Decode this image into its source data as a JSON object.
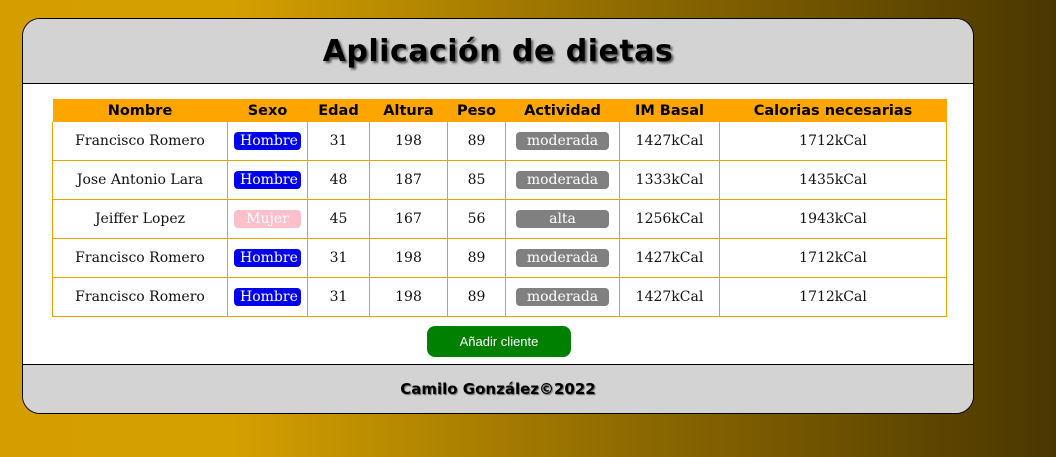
{
  "header": {
    "title": "Aplicación de dietas"
  },
  "table": {
    "columns": [
      "Nombre",
      "Sexo",
      "Edad",
      "Altura",
      "Peso",
      "Actividad",
      "IM Basal",
      "Calorias necesarias"
    ],
    "rows": [
      {
        "nombre": "Francisco Romero",
        "sexo": "Hombre",
        "edad": "31",
        "altura": "198",
        "peso": "89",
        "actividad": "moderada",
        "im_basal": "1427kCal",
        "calorias": "1712kCal"
      },
      {
        "nombre": "Jose Antonio Lara",
        "sexo": "Hombre",
        "edad": "48",
        "altura": "187",
        "peso": "85",
        "actividad": "moderada",
        "im_basal": "1333kCal",
        "calorias": "1435kCal"
      },
      {
        "nombre": "Jeiffer Lopez",
        "sexo": "Mujer",
        "edad": "45",
        "altura": "167",
        "peso": "56",
        "actividad": "alta",
        "im_basal": "1256kCal",
        "calorias": "1943kCal"
      },
      {
        "nombre": "Francisco Romero",
        "sexo": "Hombre",
        "edad": "31",
        "altura": "198",
        "peso": "89",
        "actividad": "moderada",
        "im_basal": "1427kCal",
        "calorias": "1712kCal"
      },
      {
        "nombre": "Francisco Romero",
        "sexo": "Hombre",
        "edad": "31",
        "altura": "198",
        "peso": "89",
        "actividad": "moderada",
        "im_basal": "1427kCal",
        "calorias": "1712kCal"
      }
    ]
  },
  "actions": {
    "add_client_label": "Añadir cliente"
  },
  "footer": {
    "text": "Camilo González©2022"
  },
  "colors": {
    "header_bg": "#d3d3d3",
    "table_header_bg": "#ffa500",
    "hombre_badge": "#0000ee",
    "mujer_badge": "#ffc0cb",
    "activity_badge": "#808080",
    "add_button": "#008000"
  }
}
